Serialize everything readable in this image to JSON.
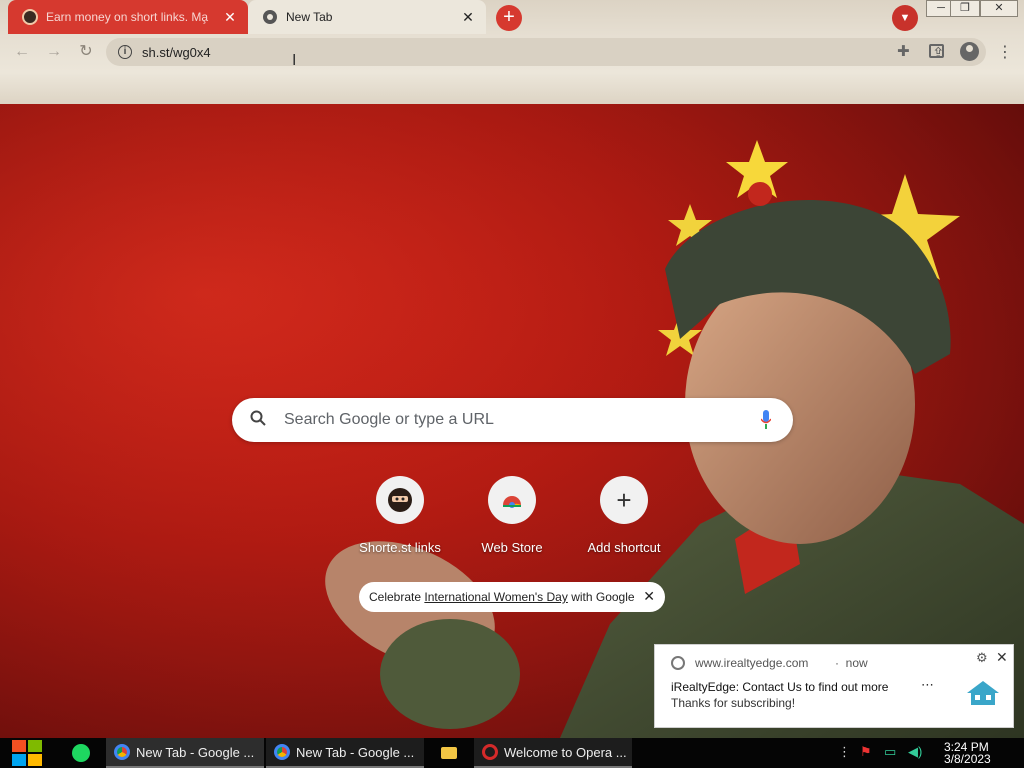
{
  "browser": {
    "tabs": [
      {
        "title": "Earn money on short links. Ma̧",
        "active": false
      },
      {
        "title": "New Tab",
        "active": true
      }
    ],
    "new_tab_symbol": "+",
    "address": "sh.st/wg0x4",
    "accent_color": "#d6392f"
  },
  "ntp": {
    "search_placeholder": "Search Google or type a URL",
    "shortcuts": [
      {
        "label": "Shorte.st links",
        "icon": "ninja-icon"
      },
      {
        "label": "Web Store",
        "icon": "chrome-webstore-icon"
      },
      {
        "label": "Add shortcut",
        "icon": "plus-icon"
      }
    ],
    "promo": {
      "prefix": "Celebrate ",
      "link": "International Women's Day",
      "suffix": " with Google"
    }
  },
  "notification": {
    "site": "www.irealtyedge.com",
    "separator": "·",
    "time": "now",
    "title": "iRealtyEdge: Contact Us to find out more",
    "body": "Thanks for subscribing!"
  },
  "taskbar": {
    "tasks": [
      {
        "label": "New Tab - Google ...",
        "icon": "chrome-icon"
      },
      {
        "label": "New Tab - Google ...",
        "icon": "chrome-icon"
      },
      {
        "label": "",
        "icon": "folder-icon"
      },
      {
        "label": "Welcome to Opera ...",
        "icon": "opera-icon"
      }
    ],
    "time": "3:24 PM",
    "date": "3/8/2023"
  }
}
